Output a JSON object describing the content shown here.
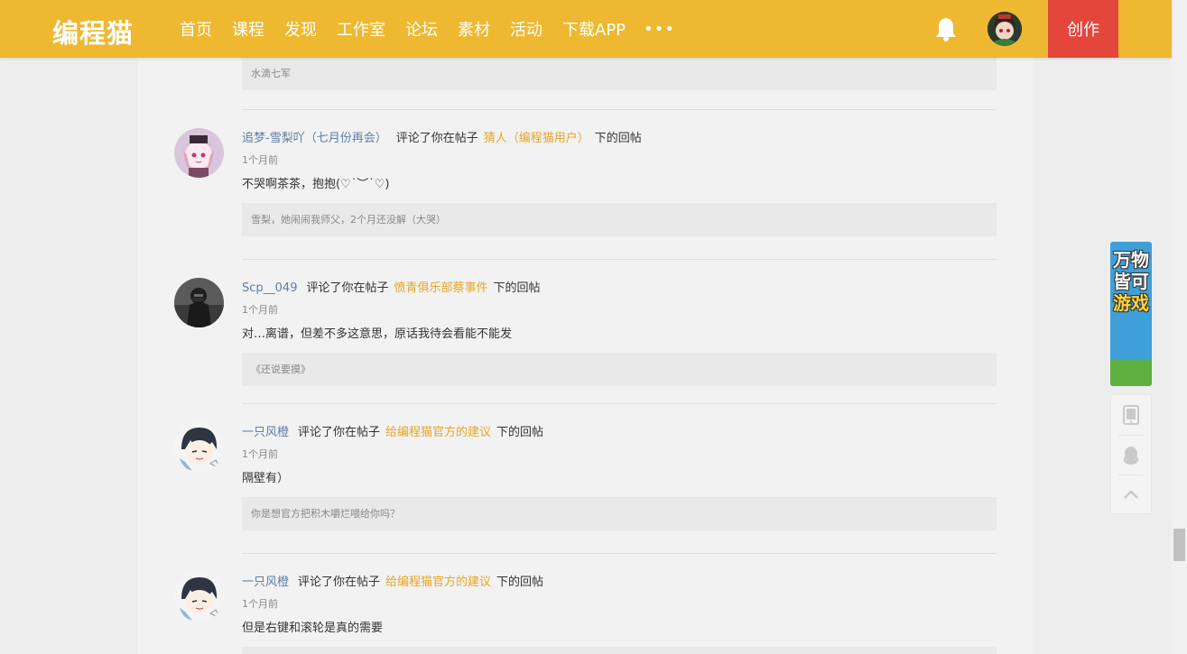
{
  "header": {
    "logo": "编程猫",
    "nav": [
      "首页",
      "课程",
      "发现",
      "工作室",
      "论坛",
      "素材",
      "活动",
      "下载APP"
    ],
    "more": "•••",
    "create_label": "创作"
  },
  "top_partial": {
    "quote": "水滴七军"
  },
  "notifications": [
    {
      "user": "追梦-雪梨吖（七月份再会）",
      "action": "评论了你在帖子",
      "post": "猜人（编程猫用户）",
      "suffix": "下的回帖",
      "time": "1个月前",
      "content": "不哭啊茶茶，抱抱(♡˙︶˙♡)",
      "quote": "雪梨，她闹闹我师父，2个月还没解（大哭）"
    },
    {
      "user": "Scp__049",
      "action": "评论了你在帖子",
      "post": "愤青俱乐部蔡事件",
      "suffix": "下的回帖",
      "time": "1个月前",
      "content": "对…离谱，但差不多这意思，原话我待会看能不能发",
      "quote": "《还说要摸》"
    },
    {
      "user": "一只风橙",
      "action": "评论了你在帖子",
      "post": "给编程猫官方的建议",
      "suffix": "下的回帖",
      "time": "1个月前",
      "content": "隔壁有）",
      "quote": "你是想官方把积木嚼烂喂给你吗？"
    },
    {
      "user": "一只风橙",
      "action": "评论了你在帖子",
      "post": "给编程猫官方的建议",
      "suffix": "下的回帖",
      "time": "1个月前",
      "content": "但是右键和滚轮是真的需要",
      "quote": ""
    }
  ],
  "side_ad": {
    "line1": "万物",
    "line2": "皆可",
    "line3": "游戏"
  },
  "side_tools": [
    "tablet-icon",
    "qq-icon",
    "chevron-up-icon"
  ],
  "colors": {
    "header": "#eeb831",
    "create": "#e4463b",
    "username": "#5f7ea5",
    "post_link": "#e8a524"
  }
}
